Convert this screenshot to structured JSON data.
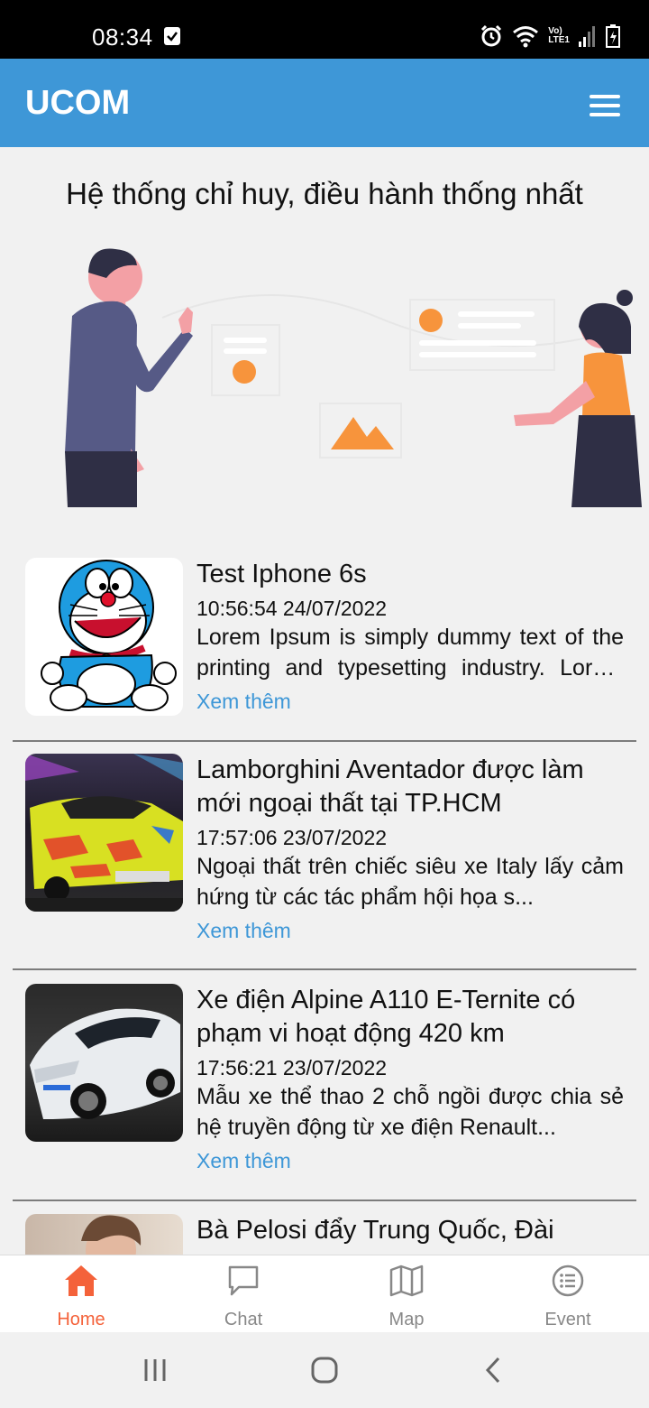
{
  "status_bar": {
    "time": "08:34",
    "icons": [
      "checkbox-notification-icon",
      "alarm-icon",
      "wifi-icon",
      "volte-lte-icon",
      "signal-icon",
      "battery-icon"
    ],
    "network_label_top": "Vo)",
    "network_label_bottom": "LTE1"
  },
  "app_bar": {
    "title": "UCOM",
    "menu_icon": "hamburger-menu-icon",
    "background": "#3e97d7"
  },
  "hero": {
    "title": "Hệ thống chỉ huy, điều hành thống nhất",
    "accent": "#f7943c"
  },
  "news": [
    {
      "title": "Test Iphone 6s",
      "time": "10:56:54 24/07/2022",
      "description": "Lorem Ipsum is simply dummy text of the printing and typesetting industry. Lorem Ipsum has been the industry's standard dummy text.",
      "more": "Xem thêm",
      "thumb": "doraemon"
    },
    {
      "title": "Lamborghini Aventador được làm mới ngoại thất tại TP.HCM",
      "time": "17:57:06 23/07/2022",
      "description": "Ngoại thất trên chiếc siêu xe Italy lấy cảm hứng từ các tác phẩm hội họa s...",
      "more": "Xem thêm",
      "thumb": "yellow-car"
    },
    {
      "title": "Xe điện Alpine A110 E-Ternite có phạm vi hoạt động 420 km",
      "time": "17:56:21 23/07/2022",
      "description": "Mẫu xe thể thao 2 chỗ ngồi được chia sẻ hệ truyền động từ xe điện Renault...",
      "more": "Xem thêm",
      "thumb": "white-car"
    },
    {
      "title": "Bà Pelosi đẩy Trung Quốc, Đài",
      "thumb": "portrait"
    }
  ],
  "bottom_nav": [
    {
      "label": "Home",
      "icon": "home-icon",
      "active": true
    },
    {
      "label": "Chat",
      "icon": "chat-bubble-icon",
      "active": false
    },
    {
      "label": "Map",
      "icon": "map-icon",
      "active": false
    },
    {
      "label": "Event",
      "icon": "list-circle-icon",
      "active": false
    }
  ],
  "colors": {
    "active": "#f4623a",
    "inactive": "#888888",
    "link": "#3e97d7"
  }
}
